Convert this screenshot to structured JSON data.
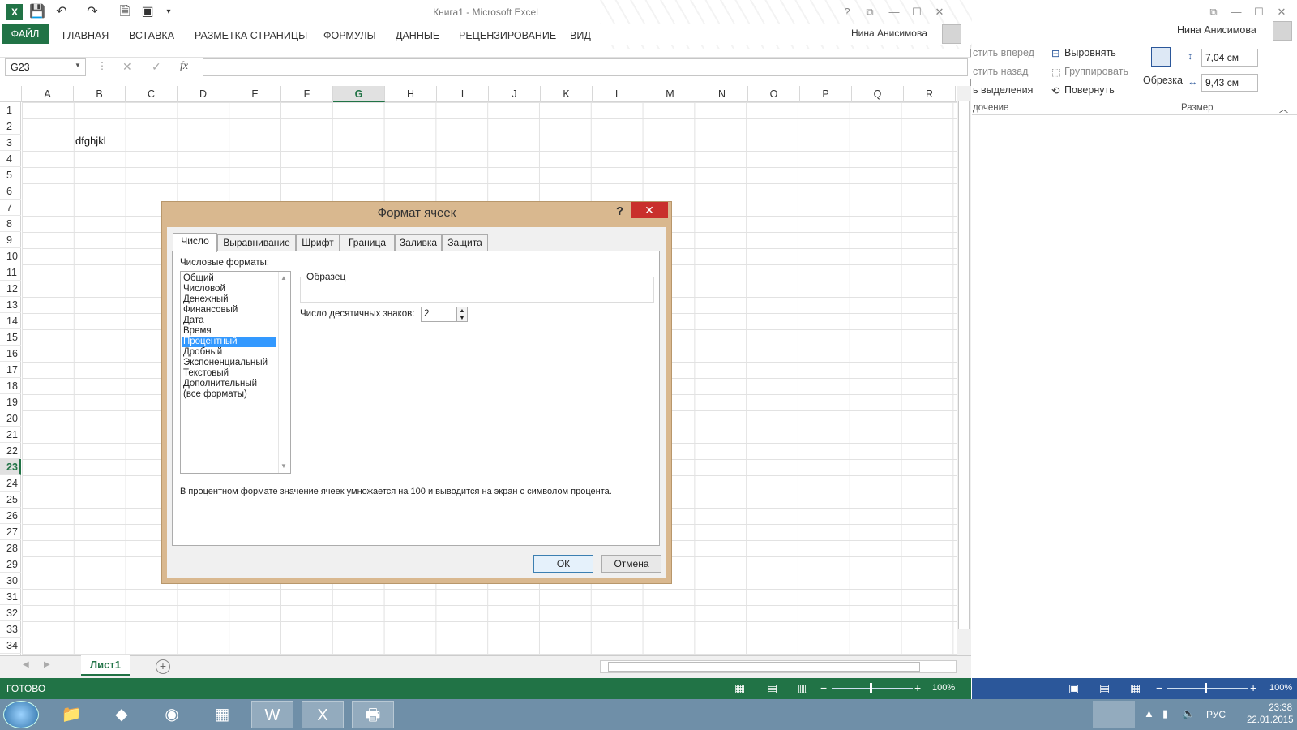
{
  "excel": {
    "title": "Книга1 - Microsoft Excel",
    "tabs": [
      "ФАЙЛ",
      "ГЛАВНАЯ",
      "ВСТАВКА",
      "РАЗМЕТКА СТРАНИЦЫ",
      "ФОРМУЛЫ",
      "ДАННЫЕ",
      "РЕЦЕНЗИРОВАНИЕ",
      "ВИД"
    ],
    "user": "Нина Анисимова",
    "name_box": "G23",
    "fx": "fx",
    "columns": [
      "A",
      "B",
      "C",
      "D",
      "E",
      "F",
      "G",
      "H",
      "I",
      "J",
      "K",
      "L",
      "M",
      "N",
      "O",
      "P",
      "Q",
      "R"
    ],
    "rows": [
      "1",
      "2",
      "3",
      "4",
      "5",
      "6",
      "7",
      "8",
      "9",
      "10",
      "11",
      "12",
      "13",
      "14",
      "15",
      "16",
      "17",
      "18",
      "19",
      "20",
      "21",
      "22",
      "23",
      "24",
      "25",
      "26",
      "27",
      "28",
      "29",
      "30",
      "31",
      "32",
      "33",
      "34"
    ],
    "selected_column": "G",
    "selected_row": "23",
    "cell_b3": "dfghjkl",
    "sheet_tab": "Лист1",
    "status": "ГОТОВО",
    "zoom": "100%"
  },
  "word": {
    "user": "Нина Анисимова",
    "bring_forward": "стить вперед",
    "send_backward": "стить назад",
    "selection_pane": "ь выделения",
    "arrange_group": "дочение",
    "align": "Выровнять",
    "group": "Группировать",
    "rotate": "Повернуть",
    "crop": "Обрезка",
    "height": "7,04 см",
    "width": "9,43 см",
    "size_group": "Размер",
    "zoom": "100%"
  },
  "dialog": {
    "title": "Формат ячеек",
    "help": "?",
    "close": "✕",
    "tabs": [
      "Число",
      "Выравнивание",
      "Шрифт",
      "Граница",
      "Заливка",
      "Защита"
    ],
    "formats_label": "Числовые форматы:",
    "formats": [
      "Общий",
      "Числовой",
      "Денежный",
      "Финансовый",
      "Дата",
      "Время",
      "Процентный",
      "Дробный",
      "Экспоненциальный",
      "Текстовый",
      "Дополнительный",
      "(все форматы)"
    ],
    "selected_format": "Процентный",
    "sample_label": "Образец",
    "decimals_label": "Число десятичных знаков:",
    "decimals_value": "2",
    "description": "В процентном формате значение ячеек умножается на 100 и выводится на экран с символом процента.",
    "ok": "ОК",
    "cancel": "Отмена"
  },
  "taskbar": {
    "lang": "РУС",
    "time": "23:38",
    "date": "22.01.2015"
  }
}
